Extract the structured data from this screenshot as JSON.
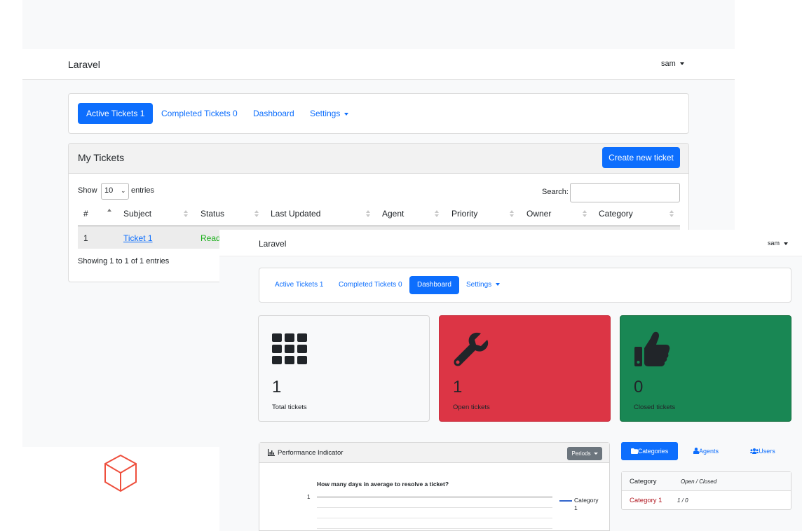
{
  "back_window": {
    "brand": "Laravel",
    "user": "sam",
    "nav": [
      {
        "label": "Active Tickets 1",
        "active": true
      },
      {
        "label": "Completed Tickets 0",
        "active": false
      },
      {
        "label": "Dashboard",
        "active": false
      },
      {
        "label": "Settings",
        "active": false
      }
    ],
    "card_title": "My Tickets",
    "create_button": "Create new ticket",
    "show_label": "Show",
    "show_value": "10",
    "entries_label": "entries",
    "search_label": "Search:",
    "search_value": "",
    "columns": [
      "#",
      "Subject",
      "Status",
      "Last Updated",
      "Agent",
      "Priority",
      "Owner",
      "Category"
    ],
    "rows": [
      {
        "id": "1",
        "subject": "Ticket 1",
        "status": "Ready"
      }
    ],
    "footer_info": "Showing 1 to 1 of 1 entries"
  },
  "front_window": {
    "brand": "Laravel",
    "user": "sam",
    "nav": [
      {
        "label": "Active Tickets 1",
        "active": false
      },
      {
        "label": "Completed Tickets 0",
        "active": false
      },
      {
        "label": "Dashboard",
        "active": true
      },
      {
        "label": "Settings",
        "active": false
      }
    ],
    "stats": [
      {
        "value": "1",
        "label": "Total tickets",
        "icon": "grid-icon",
        "bg": "#f8f9fa",
        "fg": "#212529"
      },
      {
        "value": "1",
        "label": "Open tickets",
        "icon": "wrench-icon",
        "bg": "#dc3545",
        "fg": "#212529"
      },
      {
        "value": "0",
        "label": "Closed tickets",
        "icon": "thumbs-up-icon",
        "bg": "#198754",
        "fg": "#212529"
      }
    ],
    "performance": {
      "title": "Performance Indicator",
      "periods_button": "Periods",
      "chart_title": "How many days in average to resolve a ticket?",
      "y_tick": "1",
      "legend_line1": "Category",
      "legend_line2": "1"
    },
    "side_tabs": [
      {
        "label": "Categories",
        "active": true,
        "icon": "folder-icon"
      },
      {
        "label": "Agents",
        "active": false,
        "icon": "agent-icon"
      },
      {
        "label": "Users",
        "active": false,
        "icon": "users-icon"
      }
    ],
    "category_table": {
      "header_name": "Category",
      "header_counts": "Open / Closed",
      "rows": [
        {
          "name": "Category 1",
          "counts": "1 / 0"
        }
      ]
    }
  },
  "colors": {
    "primary": "#0d6efd",
    "danger": "#dc3545",
    "success": "#198754",
    "ready_green": "#1aaf1a",
    "laravel_red": "#ee4f3d",
    "category_link": "#b0161f"
  }
}
